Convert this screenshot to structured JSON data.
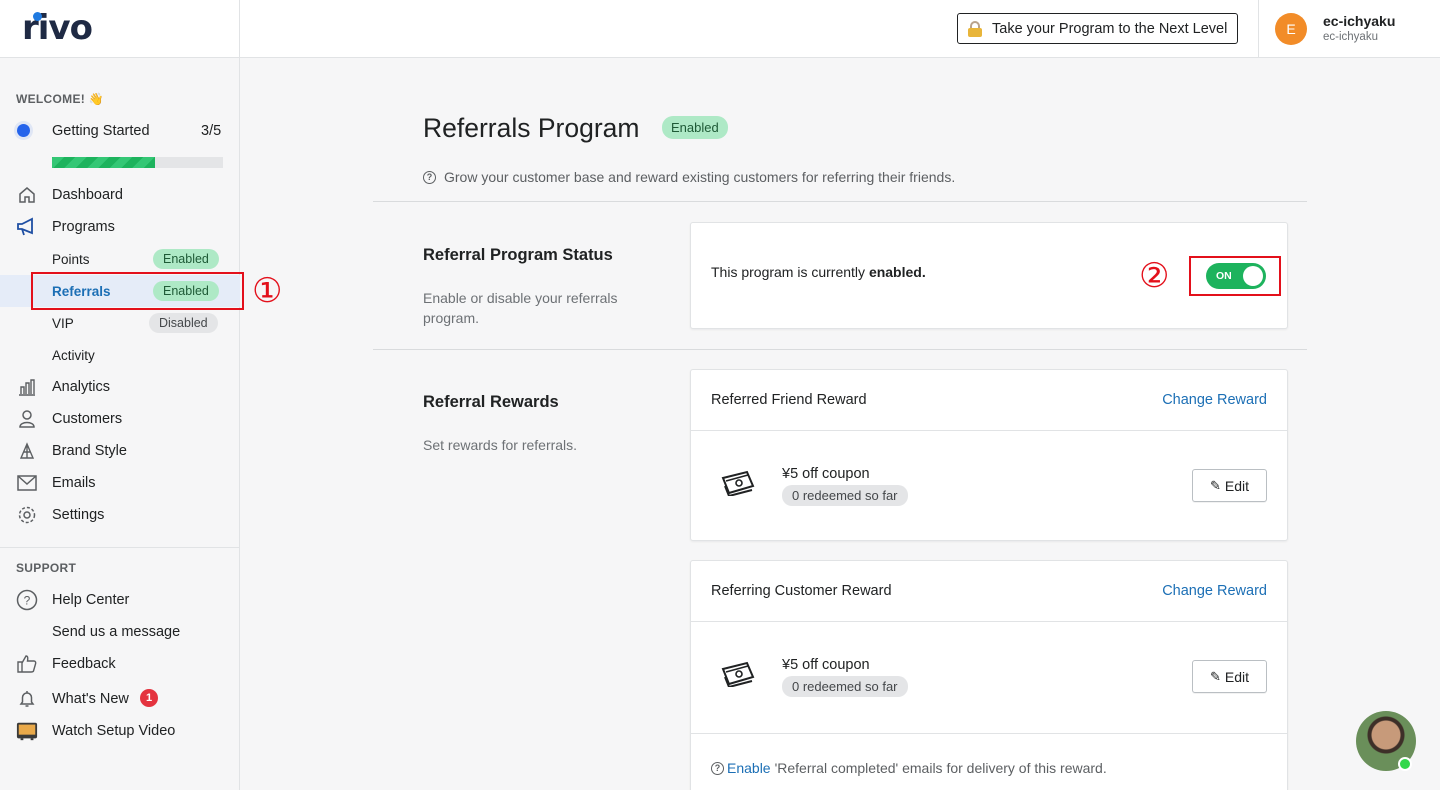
{
  "brand": {
    "name": "rivo"
  },
  "header": {
    "upgrade_label": "Take your Program to the Next Level",
    "avatar_initial": "E",
    "user_name": "ec-ichyaku",
    "shop_name": "ec-ichyaku"
  },
  "sidebar": {
    "welcome": "WELCOME! 👋",
    "getting_started": {
      "label": "Getting Started",
      "count": "3/5",
      "progress": 0.6
    },
    "items": [
      {
        "label": "Dashboard",
        "icon": "home-icon"
      },
      {
        "label": "Programs",
        "icon": "megaphone-icon"
      },
      {
        "label": "Analytics",
        "icon": "bar-chart-icon"
      },
      {
        "label": "Customers",
        "icon": "person-icon"
      },
      {
        "label": "Brand Style",
        "icon": "paint-icon"
      },
      {
        "label": "Emails",
        "icon": "envelope-icon"
      },
      {
        "label": "Settings",
        "icon": "gear-icon"
      }
    ],
    "sub_items": [
      {
        "label": "Points",
        "status": "Enabled"
      },
      {
        "label": "Referrals",
        "status": "Enabled"
      },
      {
        "label": "VIP",
        "status": "Disabled"
      },
      {
        "label": "Activity"
      }
    ],
    "support_heading": "SUPPORT",
    "support_items": [
      {
        "label": "Help Center",
        "icon": "question-circle-icon"
      },
      {
        "label": "Send us a message"
      },
      {
        "label": "Feedback",
        "icon": "thumbs-up-icon"
      },
      {
        "label": "What's New",
        "icon": "bell-icon",
        "badge": "1"
      },
      {
        "label": "Watch Setup Video",
        "icon": "tv-icon"
      }
    ]
  },
  "annotations": {
    "marker1": "①",
    "marker2": "②"
  },
  "main": {
    "title": "Referrals Program",
    "title_badge": "Enabled",
    "description": "Grow your customer base and reward existing customers for referring their friends.",
    "status_section": {
      "title": "Referral Program Status",
      "description": "Enable or disable your referrals program.",
      "status_prefix": "This program is currently ",
      "status_value": "enabled.",
      "toggle_label": "ON"
    },
    "rewards_section": {
      "title": "Referral Rewards",
      "description": "Set rewards for referrals.",
      "cards": [
        {
          "title": "Referred Friend Reward",
          "change_label": "Change Reward",
          "reward_name": "¥5 off coupon",
          "redeemed": "0 redeemed so far",
          "edit_label": "Edit"
        },
        {
          "title": "Referring Customer Reward",
          "change_label": "Change Reward",
          "reward_name": "¥5 off coupon",
          "redeemed": "0 redeemed so far",
          "edit_label": "Edit",
          "footer_link": "Enable",
          "footer_text": "'Referral completed' emails for delivery of this reward."
        }
      ]
    }
  },
  "colors": {
    "accent": "#1c6fb5",
    "success": "#1db35d",
    "annotation": "#e3101b"
  }
}
